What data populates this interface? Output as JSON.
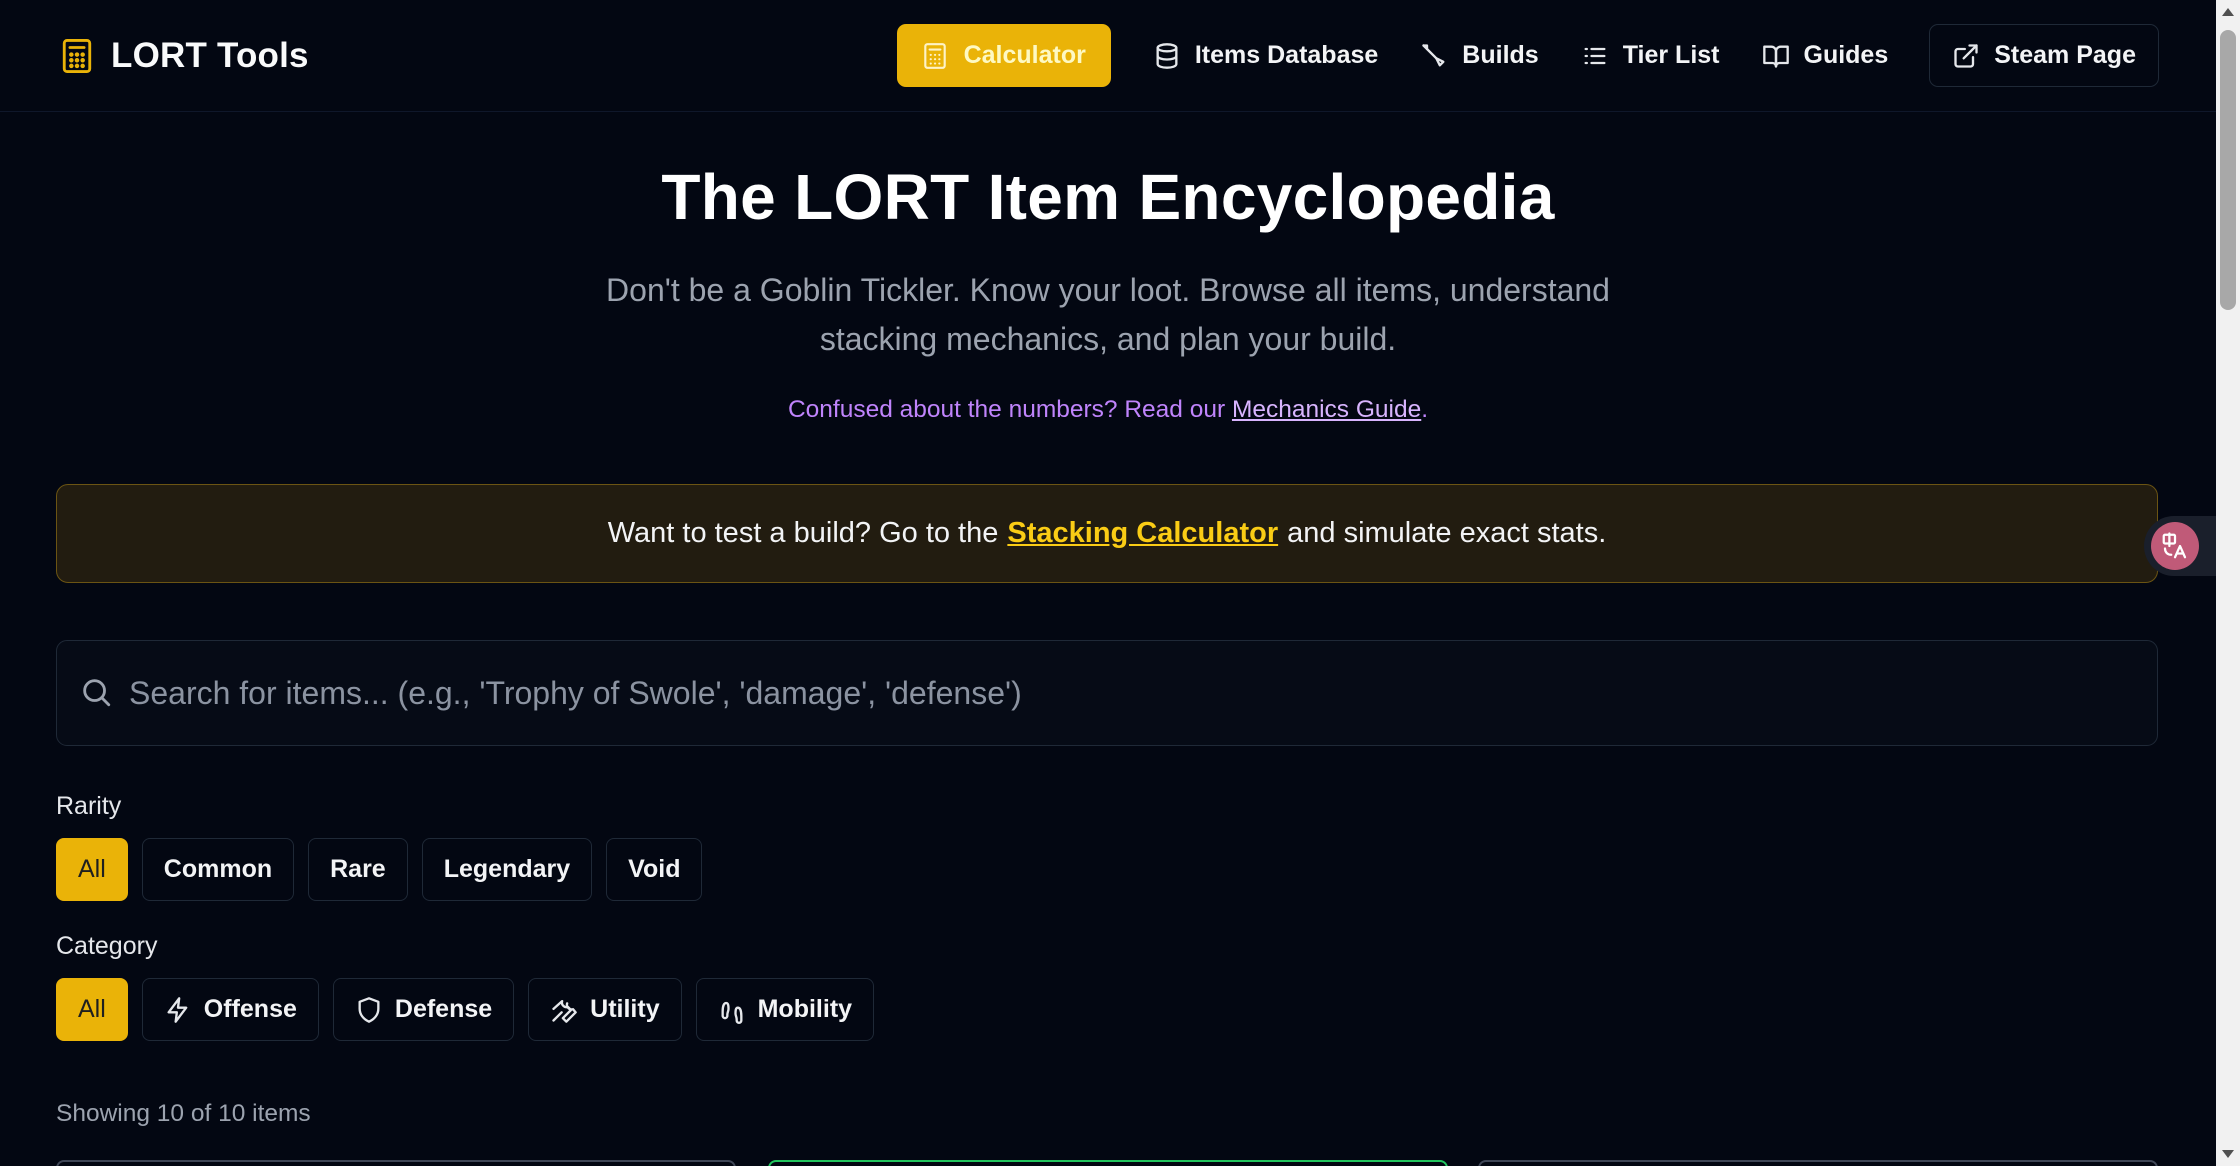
{
  "header": {
    "logo_text": "LORT Tools",
    "nav": [
      {
        "label": "Calculator",
        "icon": "calculator-icon",
        "active": true
      },
      {
        "label": "Items Database",
        "icon": "database-icon"
      },
      {
        "label": "Builds",
        "icon": "sword-icon"
      },
      {
        "label": "Tier List",
        "icon": "list-icon"
      },
      {
        "label": "Guides",
        "icon": "book-open-icon"
      },
      {
        "label": "Steam Page",
        "icon": "external-link-icon"
      }
    ]
  },
  "hero": {
    "title": "The LORT Item Encyclopedia",
    "subtitle": "Don't be a Goblin Tickler. Know your loot. Browse all items, understand stacking mechanics, and plan your build.",
    "note_prefix": "Confused about the numbers? Read our ",
    "note_link": "Mechanics Guide",
    "note_suffix": "."
  },
  "banner": {
    "prefix": "Want to test a build? Go to the",
    "link": "Stacking Calculator",
    "suffix": "and simulate exact stats."
  },
  "search": {
    "placeholder": "Search for items... (e.g., 'Trophy of Swole', 'damage', 'defense')",
    "value": ""
  },
  "filters": {
    "rarity": {
      "label": "Rarity",
      "options": [
        "All",
        "Common",
        "Rare",
        "Legendary",
        "Void"
      ],
      "selected": "All"
    },
    "category": {
      "label": "Category",
      "options": [
        {
          "label": "All",
          "icon": ""
        },
        {
          "label": "Offense",
          "icon": "lightning-icon"
        },
        {
          "label": "Defense",
          "icon": "shield-icon"
        },
        {
          "label": "Utility",
          "icon": "wrench-icon"
        },
        {
          "label": "Mobility",
          "icon": "footprints-icon"
        }
      ],
      "selected": "All"
    }
  },
  "results": {
    "count_text": "Showing 10 of 10 items"
  },
  "colors": {
    "background": "#030712",
    "accent": "#eab308",
    "link_purple": "#c084fc",
    "banner_bg": "#221c10",
    "card_green": "#22c55e"
  }
}
